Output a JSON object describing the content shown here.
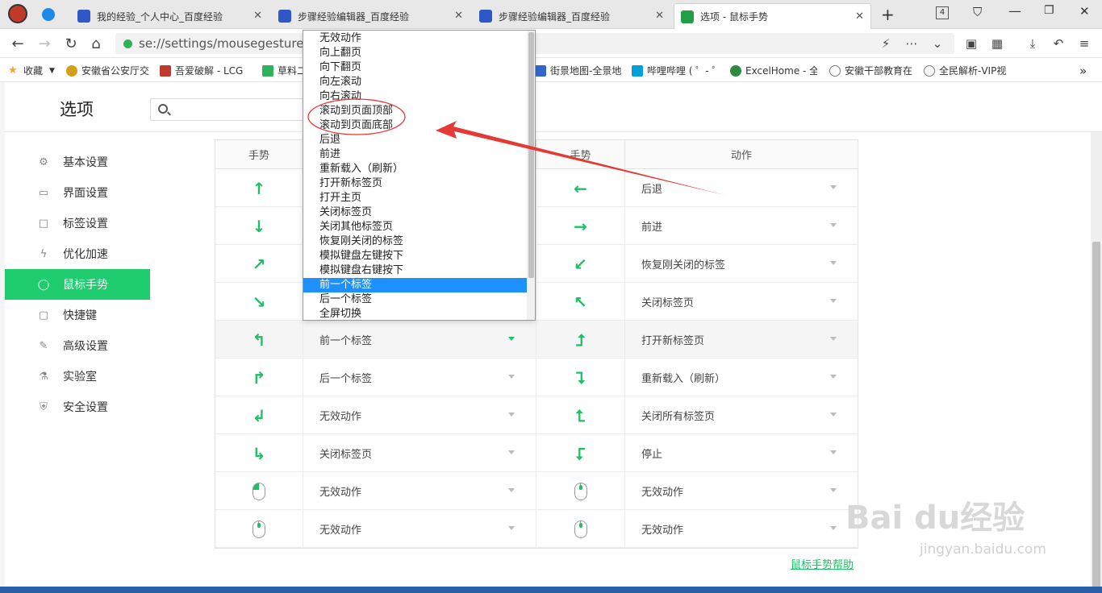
{
  "tabs": [
    {
      "label": "我的经验_个人中心_百度经验",
      "icon": "baidu-paw-icon"
    },
    {
      "label": "步骤经验编辑器_百度经验",
      "icon": "baidu-paw-icon"
    },
    {
      "label": "步骤经验编辑器_百度经验",
      "icon": "baidu-paw-icon"
    },
    {
      "label": "选项 - 鼠标手势",
      "icon": "settings-wrench-icon",
      "active": true
    }
  ],
  "tabcount": "4",
  "address": {
    "url": "se://settings/mousegestures"
  },
  "bookmarks": [
    {
      "label": "收藏"
    },
    {
      "label": "安徽省公安厅交"
    },
    {
      "label": "吾爱破解 - LCG"
    },
    {
      "label": "草料二"
    },
    {
      "label": "街景地图-全景地"
    },
    {
      "label": "哔哩哔哩 ( ゜- ゜"
    },
    {
      "label": "ExcelHome - 全"
    },
    {
      "label": "安徽干部教育在"
    },
    {
      "label": "全民解析-VIP视"
    }
  ],
  "settings": {
    "title": "选项",
    "sidebar": [
      {
        "label": "基本设置",
        "icon": "gear-icon"
      },
      {
        "label": "界面设置",
        "icon": "window-icon"
      },
      {
        "label": "标签设置",
        "icon": "tab-icon"
      },
      {
        "label": "优化加速",
        "icon": "bolt-icon"
      },
      {
        "label": "鼠标手势",
        "icon": "mouse-icon",
        "active": true
      },
      {
        "label": "快捷键",
        "icon": "keyboard-icon"
      },
      {
        "label": "高级设置",
        "icon": "wrench-icon"
      },
      {
        "label": "实验室",
        "icon": "flask-icon"
      },
      {
        "label": "安全设置",
        "icon": "shield-icon"
      }
    ],
    "table": {
      "headers": [
        "手势",
        "动作",
        "手势",
        "动作"
      ],
      "left_actions": [
        "",
        "",
        "",
        "",
        "前一个标签",
        "后一个标签",
        "无效动作",
        "关闭标签页",
        "无效动作",
        "无效动作"
      ],
      "right_actions": [
        "后退",
        "前进",
        "恢复刚关闭的标签",
        "关闭标签页",
        "打开新标签页",
        "重新载入（刷新）",
        "关闭所有标签页",
        "停止",
        "无效动作",
        "无效动作"
      ],
      "left_gestures": [
        "up-arrow-icon",
        "down-arrow-icon",
        "up-down-zigzag-icon",
        "down-up-zigzag-icon",
        "up-left-icon",
        "up-right-icon",
        "down-left-icon",
        "down-right-icon",
        "mouse-left-button-icon",
        "mouse-middle-button-icon"
      ],
      "right_gestures": [
        "left-arrow-icon",
        "right-arrow-icon",
        "left-zigzag-icon",
        "right-zigzag-icon",
        "right-up-icon",
        "right-down-icon",
        "left-up-icon",
        "left-down-icon",
        "mouse-scroll-up-icon",
        "mouse-scroll-down-icon"
      ]
    },
    "help_link": "鼠标手势帮助"
  },
  "dropdown": {
    "options": [
      "无效动作",
      "向上翻页",
      "向下翻页",
      "向左滚动",
      "向右滚动",
      "滚动到页面顶部",
      "滚动到页面底部",
      "后退",
      "前进",
      "重新载入（刷新）",
      "打开新标签页",
      "打开主页",
      "关闭标签页",
      "关闭其他标签页",
      "恢复刚关闭的标签",
      "模拟键盘左键按下",
      "模拟键盘右键按下",
      "前一个标签",
      "后一个标签",
      "全屏切换"
    ],
    "selected": "前一个标签"
  },
  "watermark": {
    "text": "Bai du经验",
    "sub": "jingyan.baidu.com"
  },
  "colors": {
    "accent": "#1fcc6e",
    "selection": "#1e90ff",
    "annotation": "#e53935"
  }
}
